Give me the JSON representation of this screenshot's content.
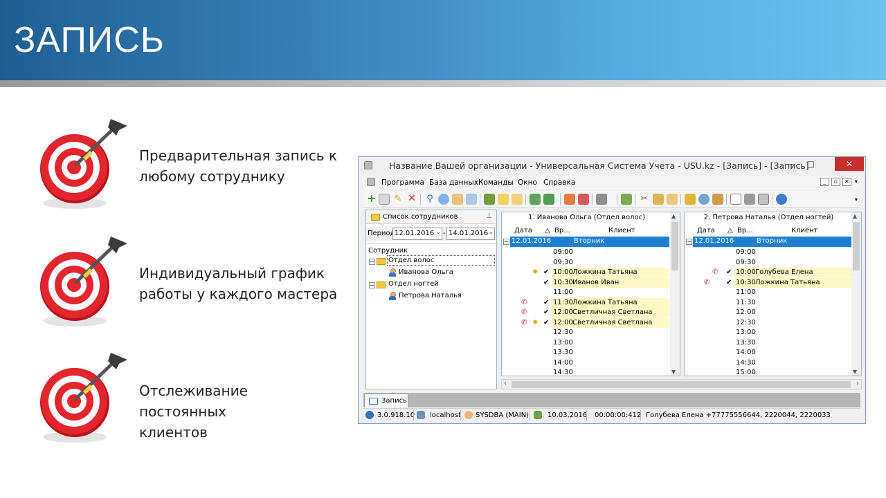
{
  "slide": {
    "title": "ЗАПИСЬ",
    "bullets": [
      "Предварительная запись к\nлюбому сотруднику",
      "Индивидуальный график\nработы у каждого мастера",
      "Отслеживание постоянных\nклиентов"
    ]
  },
  "window": {
    "title": "Название Вашей организации - Универсальная Система Учета - USU.kz - [Запись] - [Запись]",
    "menu": [
      "Программа",
      "База данных",
      "Команды",
      "Окно",
      "Справка"
    ]
  },
  "employees": {
    "tab_label": "Список сотрудников",
    "period_label": "Период",
    "date_from": "12.01.2016",
    "date_to": "14.01.2016",
    "column": "Сотрудник",
    "departments": [
      {
        "name": "Отдел волос",
        "staff": "Иванова Ольга"
      },
      {
        "name": "Отдел ногтей",
        "staff": "Петрова Наталья"
      }
    ]
  },
  "columns": {
    "date": "Дата",
    "time": "Вр...",
    "client": "Клиент"
  },
  "schedule1": {
    "title": "1. Иванова Ольга (Отдел волос)",
    "date": "12.01.2016",
    "weekday": "Вторник",
    "rows": [
      {
        "time": "09:00",
        "client": ""
      },
      {
        "time": "09:30",
        "client": ""
      },
      {
        "time": "10:00",
        "client": "Ложкина Татьяна"
      },
      {
        "time": "10:30",
        "client": "Иванов Иван"
      },
      {
        "time": "11:00",
        "client": ""
      },
      {
        "time": "11:30",
        "client": "Ложкина Татьяна"
      },
      {
        "time": "12:00",
        "client": "Светличная Светлана"
      },
      {
        "time": "12:00",
        "client": "Светличная Светлана"
      },
      {
        "time": "12:30",
        "client": ""
      },
      {
        "time": "13:00",
        "client": ""
      },
      {
        "time": "13:30",
        "client": ""
      },
      {
        "time": "14:00",
        "client": ""
      },
      {
        "time": "14:30",
        "client": ""
      }
    ]
  },
  "schedule2": {
    "title": "2. Петрова Наталья (Отдел ногтей)",
    "date": "12.01.2016",
    "weekday": "Вторник",
    "rows": [
      {
        "time": "09:00",
        "client": ""
      },
      {
        "time": "09:30",
        "client": ""
      },
      {
        "time": "10:00",
        "client": "Голубева Елена"
      },
      {
        "time": "10:30",
        "client": "Ложкина Татьяна"
      },
      {
        "time": "11:00",
        "client": ""
      },
      {
        "time": "11:30",
        "client": ""
      },
      {
        "time": "12:00",
        "client": ""
      },
      {
        "time": "12:30",
        "client": ""
      },
      {
        "time": "13:00",
        "client": ""
      },
      {
        "time": "13:30",
        "client": ""
      },
      {
        "time": "14:00",
        "client": ""
      },
      {
        "time": "14:30",
        "client": ""
      },
      {
        "time": "15:00",
        "client": ""
      }
    ]
  },
  "document_tab": "Запись",
  "status": {
    "version": "3.0.918.10",
    "server": "localhost",
    "user": "SYSDBA (MAIN)",
    "date": "10.03.2016",
    "timer": "00:00:00:412",
    "info": "Голубева Елена +77775556644, 2220044, 2220033"
  }
}
